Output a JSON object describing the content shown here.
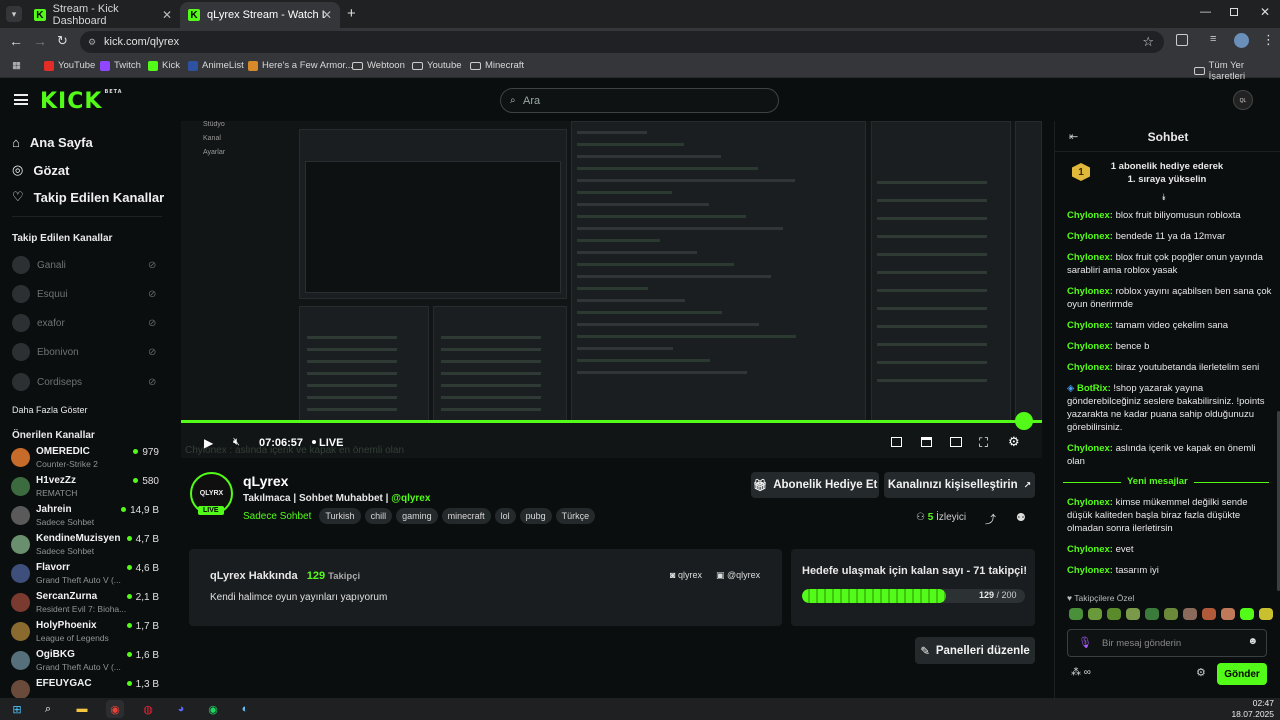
{
  "browser": {
    "tabs": [
      {
        "label": "Stream - Kick Dashboard"
      },
      {
        "label": "qLyrex Stream - Watch Live on K"
      }
    ],
    "url": "kick.com/qlyrex",
    "bookmarks": [
      "YouTube",
      "Twitch",
      "Kick",
      "AnimeList",
      "Here's a Few Armor...",
      "Webtoon",
      "Youtube",
      "Minecraft"
    ],
    "bookmarks_right": "Tüm Yer İşaretleri"
  },
  "header": {
    "logo": "KICK",
    "logo_badge": "BETA",
    "search_placeholder": "Ara"
  },
  "sidebar": {
    "nav": [
      {
        "label": "Ana Sayfa",
        "icon": "home-icon"
      },
      {
        "label": "Gözat",
        "icon": "compass-icon"
      },
      {
        "label": "Takip Edilen Kanallar",
        "icon": "heart-icon"
      }
    ],
    "followed_title": "Takip Edilen Kanallar",
    "followed": [
      "Ganali",
      "Esquui",
      "exafor",
      "Ebonivon",
      "Cordiseps"
    ],
    "show_more": "Daha Fazla Göster",
    "recommended_title": "Önerilen Kanallar",
    "recommended": [
      {
        "name": "OMEREDIC",
        "game": "Counter-Strike 2",
        "viewers": "979",
        "color": "#c76b2a"
      },
      {
        "name": "H1vezZz",
        "game": "REMATCH",
        "viewers": "580",
        "color": "#3b6b3f"
      },
      {
        "name": "Jahrein",
        "game": "Sadece Sohbet",
        "viewers": "14,9 B",
        "color": "#5a5a5a"
      },
      {
        "name": "KendineMuzisyen",
        "game": "Sadece Sohbet",
        "viewers": "4,7 B",
        "color": "#6a8f6e"
      },
      {
        "name": "Flavorr",
        "game": "Grand Theft Auto V (...",
        "viewers": "4,6 B",
        "color": "#3d4f7a"
      },
      {
        "name": "SercanZurna",
        "game": "Resident Evil 7: Bioha...",
        "viewers": "2,1 B",
        "color": "#7a3a2f"
      },
      {
        "name": "HolyPhoenix",
        "game": "League of Legends",
        "viewers": "1,7 B",
        "color": "#8a6a2f"
      },
      {
        "name": "OgiBKG",
        "game": "Grand Theft Auto V (...",
        "viewers": "1,6 B",
        "color": "#55707a"
      },
      {
        "name": "EFEUYGAC",
        "game": "",
        "viewers": "1,3 B",
        "color": "#6a4a3a"
      }
    ]
  },
  "player": {
    "time": "07:06:57",
    "live": "LIVE",
    "caption": "Chylonex : aslında içerik ve kapak en önemli olan",
    "progress": 1.0
  },
  "channel": {
    "name": "qLyrex",
    "subtitle_main": "Takılmaca | Sohbet Muhabbet |",
    "subtitle_handle": "@qlyrex",
    "live_badge": "LIVE",
    "category": "Sadece Sohbet",
    "tags": [
      "Turkish",
      "chill",
      "gaming",
      "minecraft",
      "lol",
      "pubg",
      "Türkçe"
    ],
    "gift_button": "Abonelik Hediye Et",
    "customize_button": "Kanalınızı kişiselleştirin",
    "viewer_count": "5",
    "viewer_label": "İzleyici",
    "about_title": "qLyrex Hakkında",
    "followers_count": "129",
    "followers_label": "Takipçi",
    "about_text": "Kendi halimce oyun yayınları yapıyorum",
    "social": [
      "qlyrex",
      "@qlyrex"
    ],
    "goal_title": "Hedefe ulaşmak için kalan sayı - 71 takipçi!",
    "goal_current": "129",
    "goal_total": "/ 200",
    "goal_fraction": 0.645,
    "edit_panels": "Panelleri düzenle"
  },
  "chat": {
    "title": "Sohbet",
    "pinned_rank": "1",
    "pinned_text": "1 abonelik hediye ederek 1. sıraya yükselin",
    "messages": [
      {
        "user": "Chylonex:",
        "text": "blox fruit biliyomusun robloxta"
      },
      {
        "user": "Chylonex:",
        "text": "bendede 11 ya da 12mvar"
      },
      {
        "user": "Chylonex:",
        "text": "blox fruit çok popğler onun yayında sarabliri ama roblox yasak"
      },
      {
        "user": "Chylonex:",
        "text": "roblox yayını açabilsen ben sana çok oyun önerirmde"
      },
      {
        "user": "Chylonex:",
        "text": "tamam video çekelim sana"
      },
      {
        "user": "Chylonex:",
        "text": "bence b"
      },
      {
        "user": "Chylonex:",
        "text": "biraz youtubetanda ilerletelim seni"
      },
      {
        "user": "BotRix:",
        "text": "!shop yazarak yayına gönderebilceğiniz seslere bakabilirsiniz. !points yazarakta ne kadar puana sahip olduğunuzu görebilirsiniz."
      },
      {
        "user": "Chylonex:",
        "text": "aslında içerik ve kapak en önemli olan"
      }
    ],
    "new_messages": "Yeni mesajlar",
    "messages_after": [
      {
        "user": "Chylonex:",
        "text": "kimse mükemmel değilki sende düşük kaliteden başla biraz fazla düşükte olmadan sonra ilerletirsin"
      },
      {
        "user": "Chylonex:",
        "text": "evet"
      },
      {
        "user": "Chylonex:",
        "text": "tasarım iyi"
      }
    ],
    "followers_only": "Takipçilere Özel",
    "input_placeholder": "Bir mesaj gönderin",
    "send_button": "Gönder"
  },
  "taskbar": {
    "time": "02:47",
    "date": "18.07.2025"
  }
}
